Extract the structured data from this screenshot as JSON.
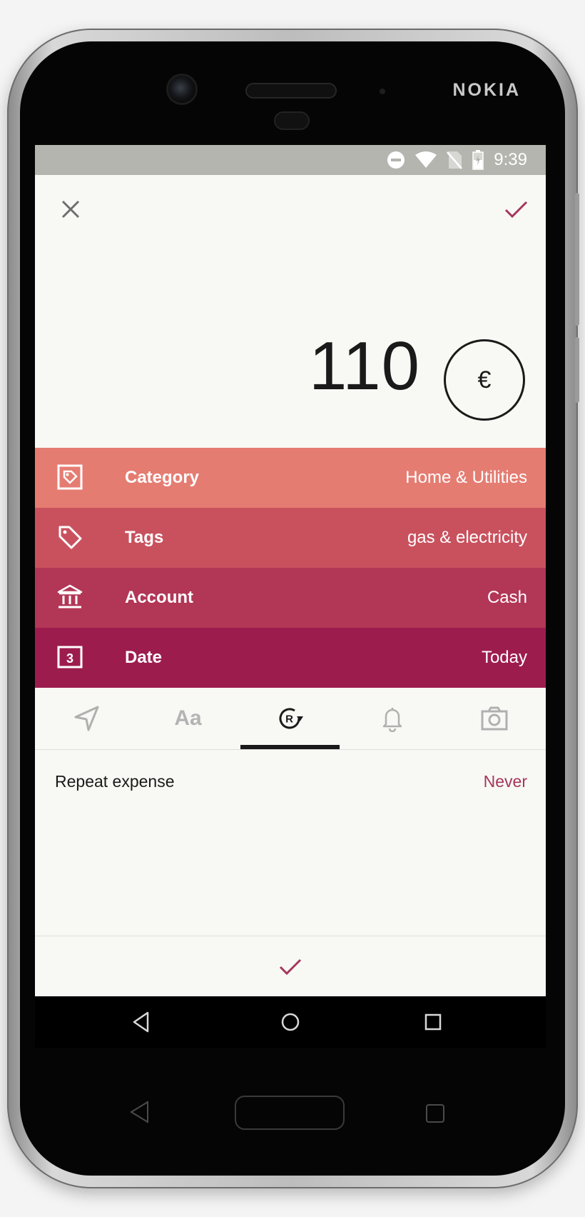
{
  "device": {
    "brand": "NOKIA"
  },
  "status_bar": {
    "time": "9:39"
  },
  "toolbar": {
    "close_icon": "close-icon",
    "confirm_icon": "check-icon"
  },
  "amount": {
    "value": "110",
    "currency_symbol": "€"
  },
  "details": [
    {
      "label": "Category",
      "value": "Home & Utilities",
      "icon": "category-tag-icon",
      "color": "#e57c72"
    },
    {
      "label": "Tags",
      "value": "gas & electricity",
      "icon": "tag-icon",
      "color": "#c9515e"
    },
    {
      "label": "Account",
      "value": "Cash",
      "icon": "bank-icon",
      "color": "#b23656"
    },
    {
      "label": "Date",
      "value": "Today",
      "icon": "calendar-icon",
      "date_number": "3",
      "color": "#9d1c4e"
    }
  ],
  "tabs": [
    {
      "name": "location",
      "icon": "location-arrow-icon",
      "active": false
    },
    {
      "name": "note",
      "icon": "text-icon",
      "text": "Aa",
      "active": false
    },
    {
      "name": "repeat",
      "icon": "recurring-icon",
      "active": true
    },
    {
      "name": "reminder",
      "icon": "bell-icon",
      "active": false
    },
    {
      "name": "photo",
      "icon": "camera-icon",
      "active": false
    }
  ],
  "repeat": {
    "label": "Repeat expense",
    "value": "Never"
  },
  "colors": {
    "accent": "#a4375d",
    "screen_bg": "#f8f8f4",
    "status_bar": "#b3b5ae"
  }
}
